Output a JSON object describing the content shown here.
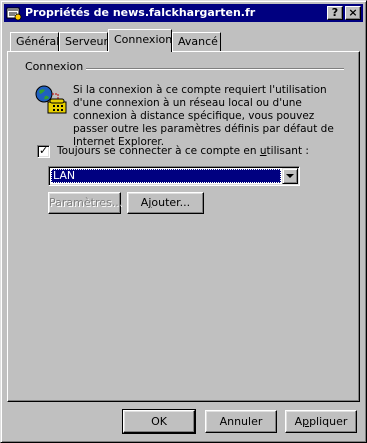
{
  "window": {
    "title": "Propriétés de news.falckhargarten.fr",
    "help_label": "?",
    "close_label": "×"
  },
  "tabs": [
    {
      "label": "Général"
    },
    {
      "label": "Serveur"
    },
    {
      "label": "Connexion"
    },
    {
      "label": "Avancé"
    }
  ],
  "connexion": {
    "group_title": "Connexion",
    "description": "Si la connexion à ce compte requiert l'utilisation d'une connexion à un réseau local ou d'une connexion à distance spécifique, vous pouvez passer outre les paramètres définis par défaut de Internet Explorer.",
    "checkbox_label_pre": "Toujours se connecter à ce compte en ",
    "checkbox_label_ul": "u",
    "checkbox_label_post": "tilisant :",
    "checkbox_checked": true,
    "checkmark": "✓",
    "connection_value": "LAN",
    "params_label": "Paramètres...",
    "add_label_pre": "A",
    "add_label_ul": "j",
    "add_label_post": "outer..."
  },
  "footer": {
    "ok_label": "OK",
    "cancel_label": "Annuler",
    "apply_label_pre": "A",
    "apply_label_ul": "p",
    "apply_label_post": "pliquer"
  },
  "colors": {
    "titlebar": "#000080",
    "face": "#c0c0c0",
    "selection": "#000080"
  }
}
